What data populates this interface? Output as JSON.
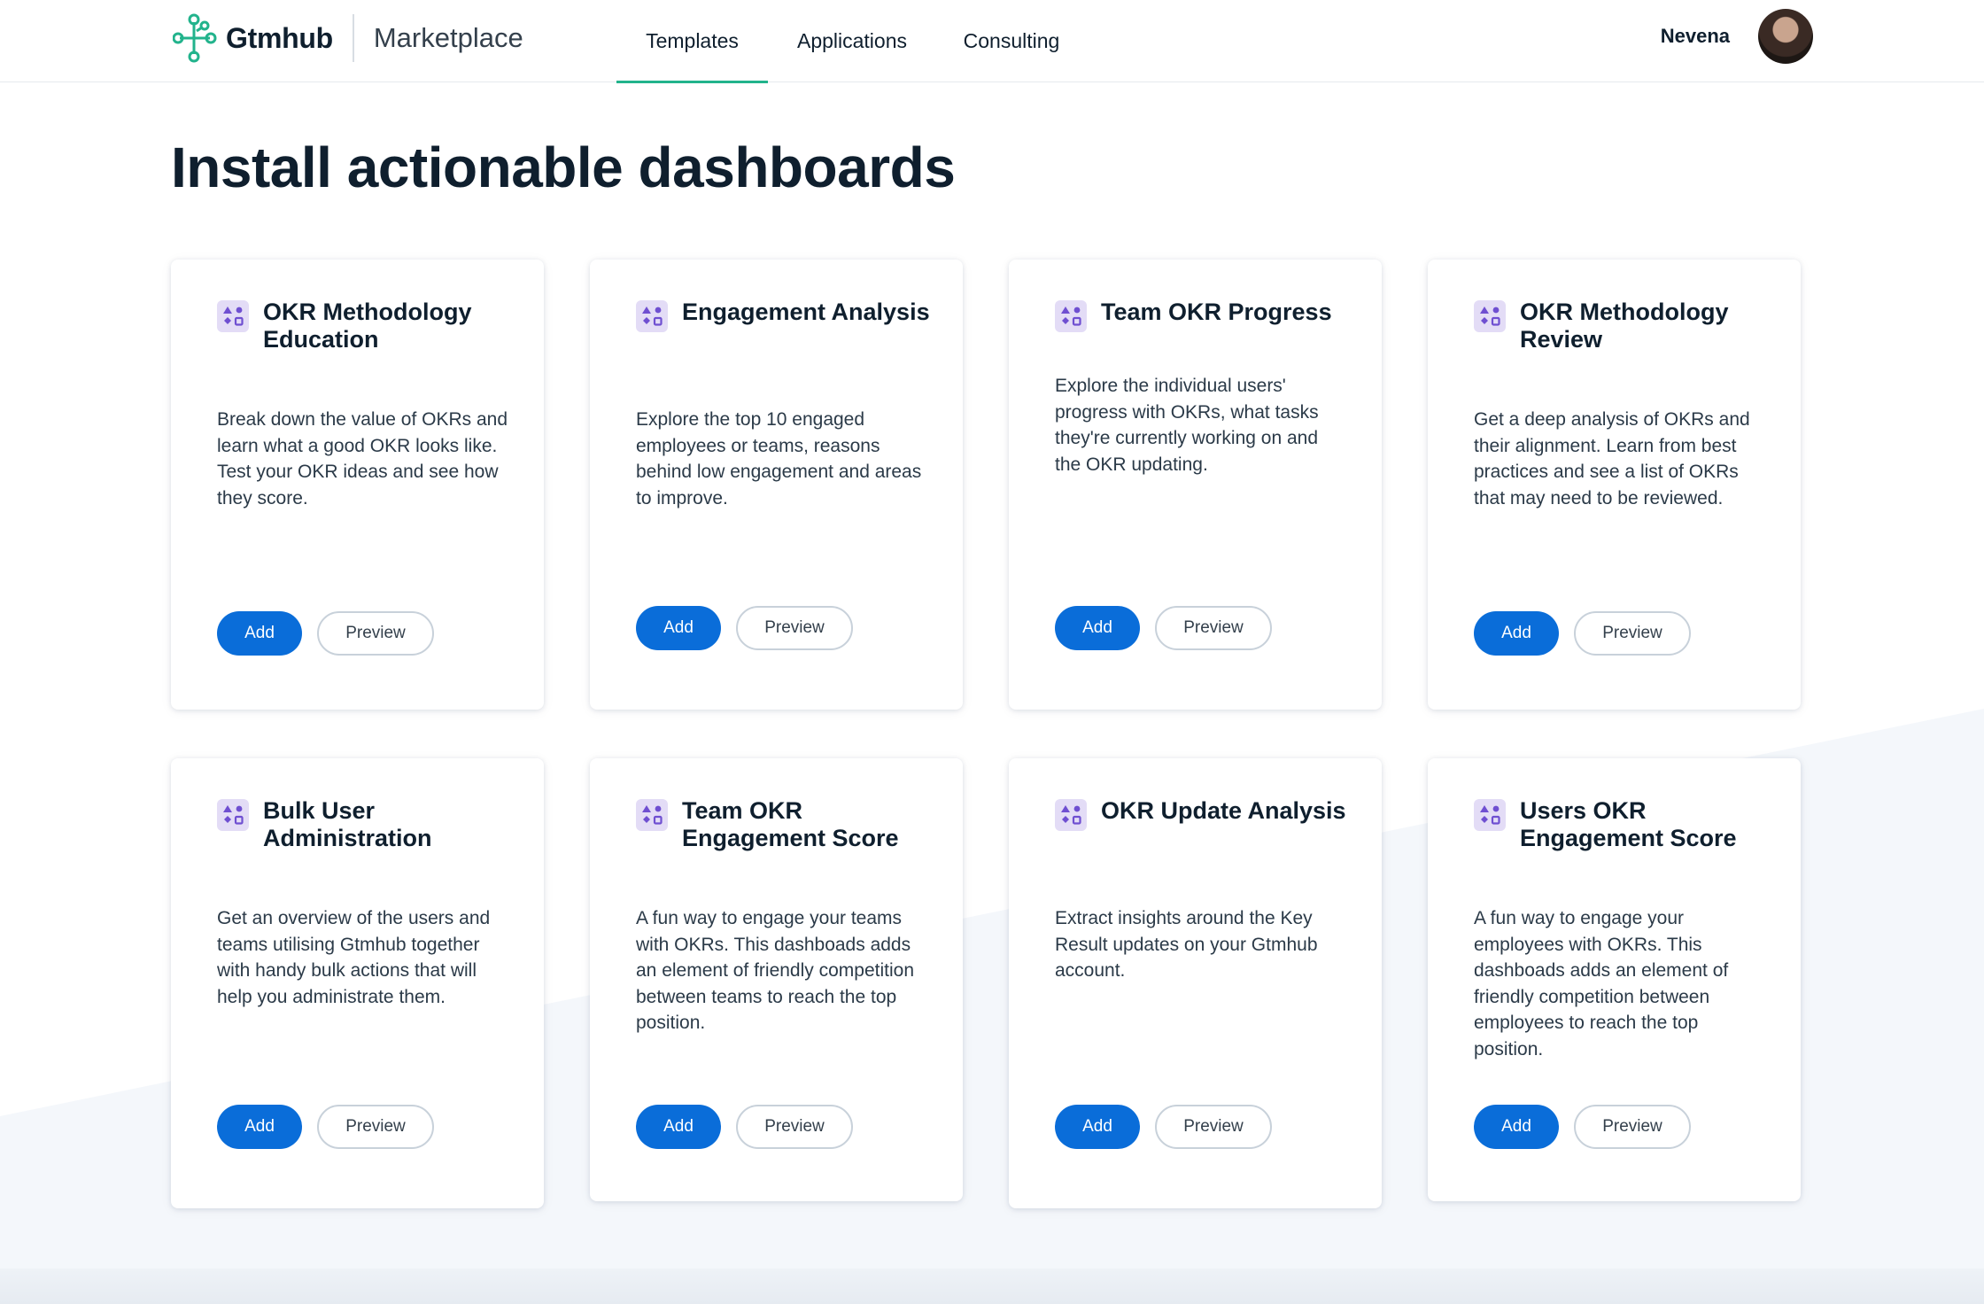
{
  "header": {
    "brand": "Gtmhub",
    "product": "Marketplace",
    "nav": [
      {
        "label": "Templates",
        "active": true
      },
      {
        "label": "Applications",
        "active": false
      },
      {
        "label": "Consulting",
        "active": false
      }
    ],
    "user_name": "Nevena"
  },
  "page_title": "Install actionable dashboards",
  "colors": {
    "accent": "#22b38c",
    "primary_button": "#0a6dd9",
    "icon_bg": "#e3dcf6",
    "icon_fg": "#6f4fd1"
  },
  "buttons": {
    "add_label": "Add",
    "preview_label": "Preview"
  },
  "cards": [
    {
      "title": "OKR Methodology Education",
      "description": "Break down the value of OKRs and learn what a good OKR looks like. Test your OKR ideas and see how they score.",
      "icon": "widgets-icon"
    },
    {
      "title": "Engagement Analysis",
      "description": "Explore the top 10 engaged employees or teams, reasons behind low engagement and areas to improve.",
      "icon": "widgets-icon"
    },
    {
      "title": "Team OKR Progress",
      "description": "Explore the individual users' progress with OKRs, what tasks they're currently working on and the OKR updating.",
      "icon": "widgets-icon"
    },
    {
      "title": "OKR Methodology Review",
      "description": "Get a deep analysis of OKRs and their alignment. Learn from best practices and see a list of OKRs that may need to be reviewed.",
      "icon": "widgets-icon"
    },
    {
      "title": "Bulk User Administration",
      "description": "Get an overview of the users and teams utilising Gtmhub together with handy bulk actions that will help you administrate them.",
      "icon": "widgets-icon"
    },
    {
      "title": "Team OKR Engagement Score",
      "description": "A fun way to engage your teams with OKRs. This dashboads adds an element of friendly competition between teams to reach the top position.",
      "icon": "widgets-icon"
    },
    {
      "title": "OKR Update Analysis",
      "description": "Extract insights around the Key Result updates on your Gtmhub account.",
      "icon": "widgets-icon"
    },
    {
      "title": "Users OKR Engagement Score",
      "description": "A fun way to engage your employees with OKRs. This dashboads adds an element of friendly competition between employees to reach the top position.",
      "icon": "widgets-icon"
    }
  ]
}
